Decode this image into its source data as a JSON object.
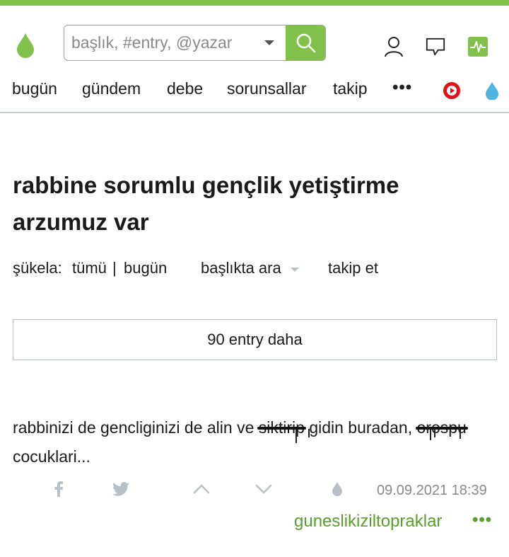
{
  "header": {
    "search": {
      "placeholder": "başlık, #entry, @yazar"
    }
  },
  "nav": {
    "items": [
      {
        "label": "bugün"
      },
      {
        "label": "gündem"
      },
      {
        "label": "debe"
      },
      {
        "label": "sorunsallar"
      },
      {
        "label": "takip"
      }
    ],
    "more_label": "•••"
  },
  "topic": {
    "title": "rabbine sorumlu gençlik yetiştirme arzumuz var",
    "filters": {
      "sukela_label": "şükela:",
      "all_label": "tümü",
      "separator": "|",
      "today_label": "bugün",
      "search_in_topic_label": "başlıkta ara",
      "follow_label": "takip et"
    },
    "more_entries_label": "90 entry daha"
  },
  "entry": {
    "text_part1": "rabbinizi de gencliginizi de alin ve ",
    "censored_word1": "siktirip",
    "text_part2": " gidin buradan, ",
    "censored_word2": "orospu",
    "text_part3": " cocuklari...",
    "date": "09.09.2021 18:39",
    "author": "guneslikiziltopraklar",
    "author_more_label": "•••"
  },
  "colors": {
    "brand_green": "#81c14b",
    "author_green": "#5a9e2c",
    "muted_gray": "#8a8a8a"
  },
  "icons": {
    "logo": "drop-logo-icon",
    "search": "search-icon",
    "user": "user-icon",
    "messages": "speech-bubble-icon",
    "activity": "activity-icon",
    "video": "play-circle-icon",
    "drop": "drop-icon",
    "facebook": "facebook-icon",
    "twitter": "twitter-icon",
    "upvote": "chevron-up-icon",
    "downvote": "chevron-down-icon",
    "favorite": "drop-favorite-icon"
  }
}
